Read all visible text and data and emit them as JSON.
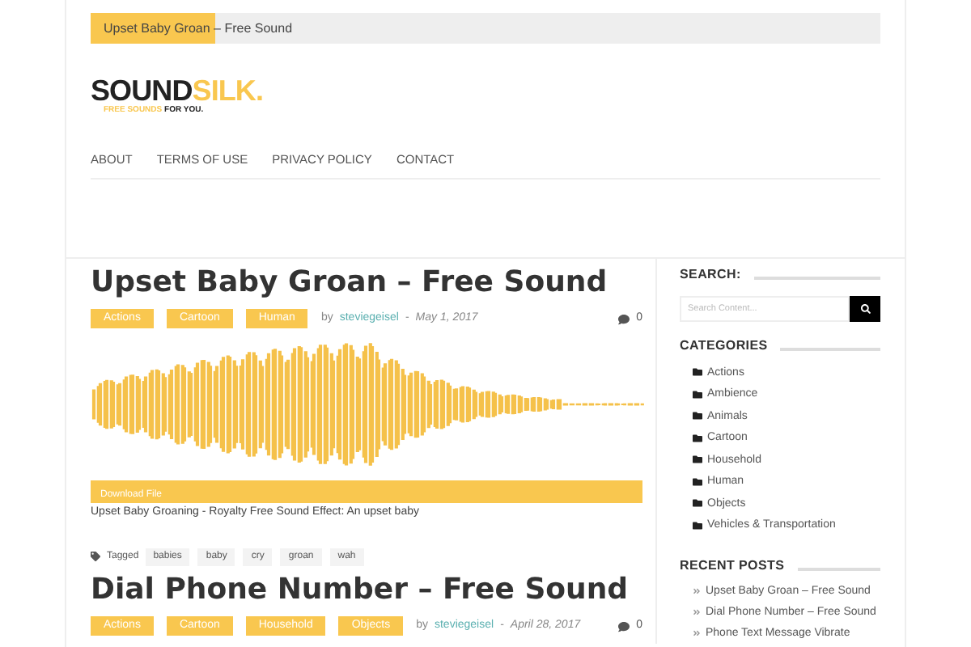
{
  "ticker": {
    "label": "Upset Baby Groan – Free Sound"
  },
  "logo": {
    "word_dark": "SOUND",
    "word_light": "SILK.",
    "tagline_light": "FREE SOUNDS",
    "tagline_dark": "FOR YOU."
  },
  "nav": [
    "ABOUT",
    "TERMS OF USE",
    "PRIVACY POLICY",
    "CONTACT"
  ],
  "posts": [
    {
      "title": "Upset Baby Groan – Free Sound",
      "categories": [
        "Actions",
        "Cartoon",
        "Human"
      ],
      "by": "by",
      "author": "steviegeisel",
      "sep": "-",
      "date": "May 1, 2017",
      "comments": "0",
      "download": "Download File",
      "caption": "Upset Baby Groaning - Royalty Free Sound Effect: An upset baby",
      "tagged": "Tagged",
      "tags": [
        "babies",
        "baby",
        "cry",
        "groan",
        "wah"
      ]
    },
    {
      "title": "Dial Phone Number – Free Sound",
      "categories": [
        "Actions",
        "Cartoon",
        "Household",
        "Objects"
      ],
      "by": "by",
      "author": "steviegeisel",
      "sep": "-",
      "date": "April 28, 2017",
      "comments": "0"
    }
  ],
  "sidebar": {
    "search_heading": "SEARCH:",
    "search": {
      "placeholder": "Search Content..."
    },
    "categories_heading": "CATEGORIES",
    "categories": [
      "Actions",
      "Ambience",
      "Animals",
      "Cartoon",
      "Household",
      "Human",
      "Objects",
      "Vehicles & Transportation"
    ],
    "recent_heading": "RECENT POSTS",
    "recent": [
      "Upset Baby Groan – Free Sound",
      "Dial Phone Number – Free Sound",
      "Phone Text Message Vibrate"
    ]
  }
}
